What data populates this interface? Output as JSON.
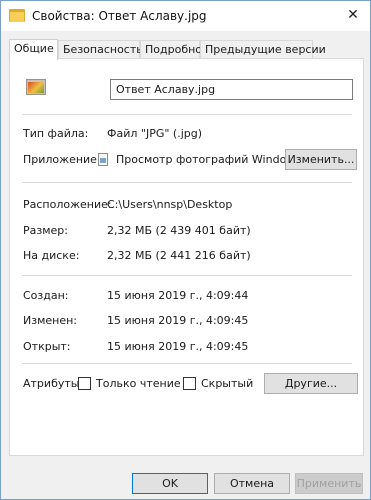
{
  "window": {
    "title": "Свойства: Ответ Аславу.jpg",
    "close_glyph": "✕"
  },
  "tabs": [
    {
      "label": "Общие"
    },
    {
      "label": "Безопасность"
    },
    {
      "label": "Подробно"
    },
    {
      "label": "Предыдущие версии"
    }
  ],
  "general": {
    "file_name": "Ответ Аславу.jpg",
    "file_type_label": "Тип файла:",
    "file_type_value": "Файл \"JPG\" (.jpg)",
    "app_label": "Приложение:",
    "app_value": "Просмотр фотографий Windows",
    "change_button": "Изменить...",
    "location_label": "Расположение:",
    "location_value": "C:\\Users\\nnsp\\Desktop",
    "size_label": "Размер:",
    "size_value": "2,32 МБ (2 439 401 байт)",
    "disk_size_label": "На диске:",
    "disk_size_value": "2,32 МБ (2 441 216 байт)",
    "created_label": "Создан:",
    "created_value": "15 июня 2019 г., 4:09:44",
    "modified_label": "Изменен:",
    "modified_value": "15 июня 2019 г., 4:09:45",
    "accessed_label": "Открыт:",
    "accessed_value": "15 июня 2019 г., 4:09:45",
    "attributes_label": "Атрибуты:",
    "readonly_label": "Только чтение",
    "readonly_checked": false,
    "hidden_label": "Скрытый",
    "hidden_checked": false,
    "other_button": "Другие..."
  },
  "footer": {
    "ok": "OK",
    "cancel": "Отмена",
    "apply": "Применить"
  }
}
